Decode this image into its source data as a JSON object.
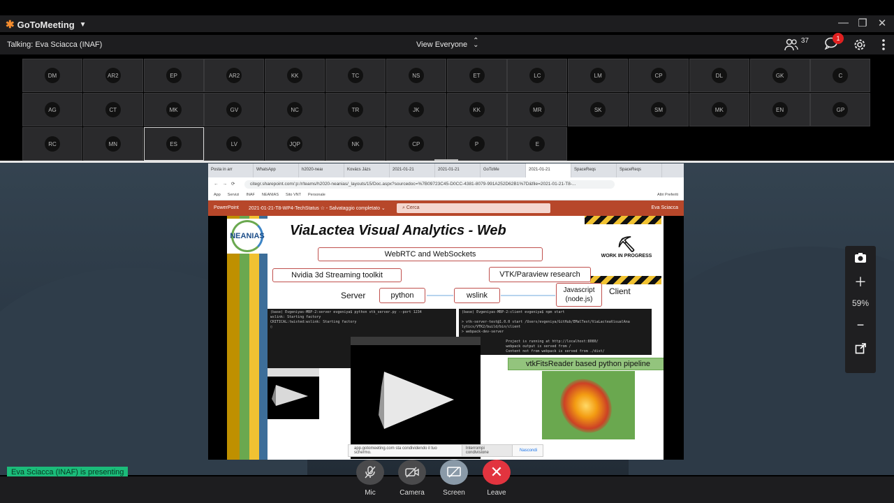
{
  "app": {
    "name": "GoToMeeting"
  },
  "window_controls": [
    "—",
    "❐",
    "✕"
  ],
  "infobar": {
    "talking": "Talking: Eva Sciacca (INAF)",
    "view": "View Everyone",
    "participant_count": "37",
    "chat_badge": "1"
  },
  "participants": [
    [
      "DM",
      "AR2",
      "EP",
      "AR2",
      "KK",
      "TC",
      "NS",
      "ET",
      "LC",
      "LM",
      "CP",
      "DL",
      "GK",
      "C"
    ],
    [
      "AG",
      "CT",
      "MK",
      "GV",
      "NC",
      "TR",
      "JK",
      "KK",
      "MR",
      "SK",
      "SM",
      "MK",
      "EN",
      "GP"
    ],
    [
      "RC",
      "MN",
      "ES",
      "LV",
      "JQP",
      "NK",
      "CP",
      "P",
      "E"
    ]
  ],
  "active_participant": "ES",
  "browser": {
    "tabs": [
      "Posta in arr",
      "WhatsApp",
      "h2020-neaı",
      "Kovács Jázs",
      "2021-01-21",
      "2021-01-21",
      "GoToMe",
      "2021-01-21",
      "SpaceReqs",
      "SpaceReqs"
    ],
    "url": "citegr.sharepoint.com/:p:/r/teams/h2020-neanias/_layouts/15/Doc.aspx?sourcedoc=%7B09723C45-D0CC-4381-8079-991A252D62B1%7D&file=2021-01-21-T8-...",
    "bookmarks": [
      "App",
      "Servizi",
      "INAF",
      "NEANIAS",
      "Sito VNT",
      "Personale",
      "Altri Preferiti"
    ]
  },
  "powerpoint": {
    "app": "PowerPoint",
    "doc": "2021-01-21-T8-WP4-TechStatus ☆ - Salvataggio completato ⌄",
    "search": "Cerca",
    "user": "Eva Sciacca"
  },
  "slide": {
    "title": "ViaLactea Visual Analytics - Web",
    "logo": "NEANIAS",
    "webrtc": "WebRTC and WebSockets",
    "nvidia": "Nvidia 3d Streaming toolkit",
    "vtk": "VTK/Paraview research",
    "server": "Server",
    "python": "python",
    "wslink": "wslink",
    "javascript": "Javascript\n(node.js)",
    "client": "Client",
    "wip": "WORK IN PROGRESS",
    "term_left": "(base) Evgeniyas-MBP-2:server evgeniya$ python vtk_server.py --port 1234\nwslink: Starting factory\nCRITICAL:twisted:wslink: Starting factory\n▯",
    "term_right": "(base) Evgeniyas-MBP-2:client evgeniya$ npm start\n\n> vtk-server-test@1.0.0 start /Users/evgeniya/GitHub/EMalTest/ViaLacteaVisualAna\nlytics/VTK2/build/bin/client\n> webpack-dev-server\n\n                     Project is running at http://localhost:8080/\n                     webpack output is served from /\n                     Content not from webpack is served from ./dist/",
    "fits": "vtkFitsReader based python pipeline"
  },
  "share_notice": {
    "text": "app.gotomeeting.com sta condividendo il tuo schermo.",
    "stop": "Interrompi condivisione",
    "hide": "Nascondi"
  },
  "side": {
    "zoom": "59%"
  },
  "presenting": "Eva Sciacca (INAF) is presenting",
  "controls": {
    "mic": "Mic",
    "camera": "Camera",
    "screen": "Screen",
    "leave": "Leave"
  }
}
